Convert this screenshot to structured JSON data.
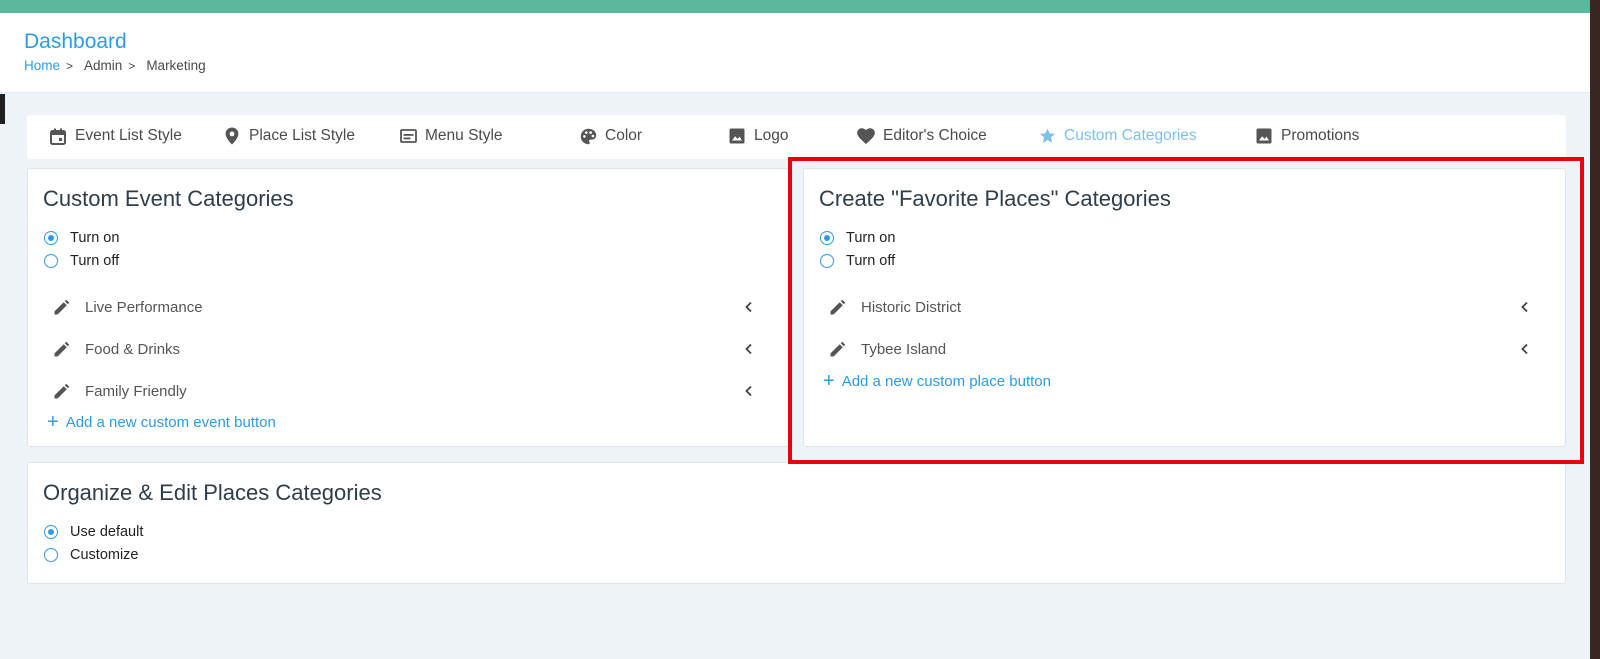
{
  "header": {
    "title": "Dashboard",
    "breadcrumb": [
      "Home",
      "Admin",
      "Marketing"
    ],
    "separator": ">"
  },
  "tabs": [
    {
      "label": "Event List Style",
      "icon": "calendar-icon"
    },
    {
      "label": "Place List Style",
      "icon": "map-pin-icon"
    },
    {
      "label": "Menu Style",
      "icon": "menu-card-icon"
    },
    {
      "label": "Color",
      "icon": "palette-icon"
    },
    {
      "label": "Logo",
      "icon": "image-icon"
    },
    {
      "label": "Editor's Choice",
      "icon": "heart-icon"
    },
    {
      "label": "Custom Categories",
      "icon": "star-icon",
      "active": true
    },
    {
      "label": "Promotions",
      "icon": "image-icon"
    }
  ],
  "event_card": {
    "title": "Custom Event Categories",
    "options": [
      {
        "label": "Turn on",
        "selected": true
      },
      {
        "label": "Turn off",
        "selected": false
      }
    ],
    "items": [
      "Live Performance",
      "Food & Drinks",
      "Family Friendly"
    ],
    "add_label": "Add a new custom event button"
  },
  "places_card": {
    "title": "Create \"Favorite Places\" Categories",
    "options": [
      {
        "label": "Turn on",
        "selected": true
      },
      {
        "label": "Turn off",
        "selected": false
      }
    ],
    "items": [
      "Historic District",
      "Tybee Island"
    ],
    "add_label": "Add a new custom place button"
  },
  "organize_card": {
    "title": "Organize & Edit Places Categories",
    "options": [
      {
        "label": "Use default",
        "selected": true
      },
      {
        "label": "Customize",
        "selected": false
      }
    ]
  },
  "colors": {
    "accent": "#2e9be4",
    "topbar": "#5cb89c",
    "highlight": "#e8000b",
    "active_tab": "#7cc0ee"
  }
}
